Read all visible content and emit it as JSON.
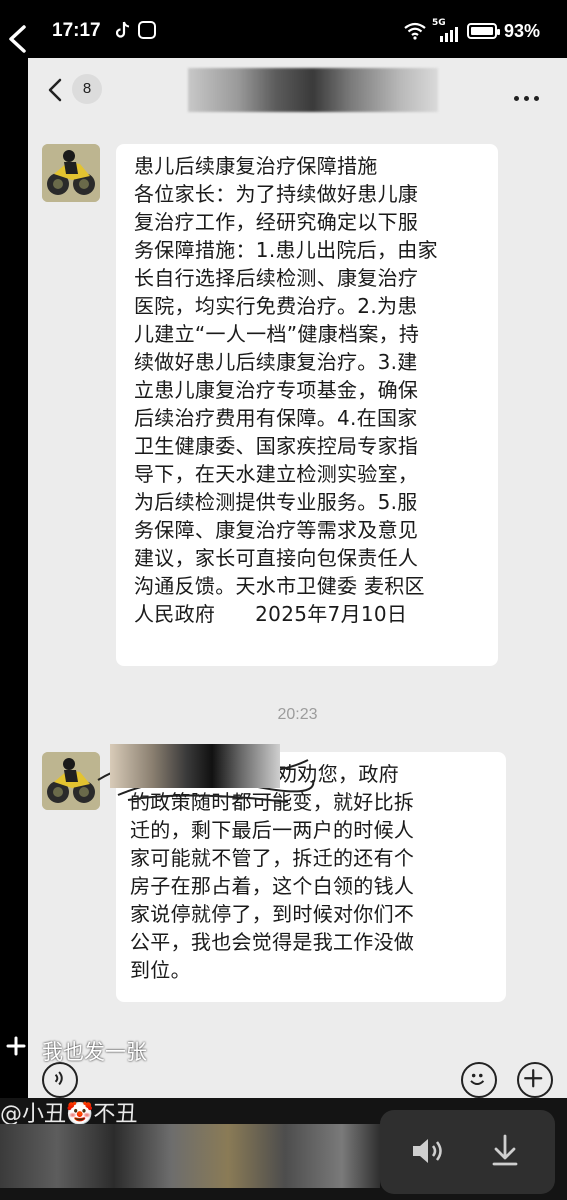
{
  "status_bar": {
    "time": "17:17",
    "network": "5G",
    "battery": "93%",
    "battery_level": 0.93
  },
  "chat": {
    "unread_count": "8",
    "timestamp": "20:23",
    "messages": [
      {
        "lines": [
          "患儿后续康复治疗保障措施",
          "各位家长：为了持续做好患儿康",
          "复治疗工作，经研究确定以下服",
          "务保障措施：1.患儿出院后，由家",
          "长自行选择后续检测、康复治疗",
          "医院，均实行免费治疗。2.为患",
          "儿建立“一人一档”健康档案，持",
          "续做好患儿后续康复治疗。3.建",
          "立患儿康复治疗专项基金，确保",
          "后续治疗费用有保障。4.在国家",
          "卫生健康委、国家疾控局专家指",
          "导下，在天水建立检测实验室，",
          "为后续检测提供专业服务。5.服",
          "务保障、康复治疗等需求及意见",
          "建议，家长可直接向包保责任人",
          "沟通反馈。天水市卫健委 麦积区",
          "人民政府      2025年7月10日"
        ]
      },
      {
        "lines": [
          "                我再劝劝您，政府",
          "的政策随时都可能变，就好比拆",
          "迁的，剩下最后一两户的时候人",
          "家可能就不管了，拆迁的还有个",
          "房子在那占着，这个白领的钱人",
          "家说停就停了，到时候对你们不",
          "公平，我也会觉得是我工作没做",
          "到位。"
        ]
      }
    ]
  },
  "overlay": {
    "post_label": "我也发一张"
  },
  "bottom": {
    "mention": "@小丑🤡不丑"
  },
  "icons": [
    "back-icon",
    "tiktok-icon",
    "app-icon",
    "wifi-icon",
    "signal-icon",
    "battery-icon",
    "chat-back-icon",
    "more-icon",
    "plus-icon",
    "voice-icon",
    "emoji-icon",
    "add-icon",
    "speaker-icon",
    "download-icon"
  ],
  "colors": {
    "chat_bg": "#ececec",
    "bubble_bg": "#ffffff",
    "timestamp": "#9c9c9c"
  }
}
